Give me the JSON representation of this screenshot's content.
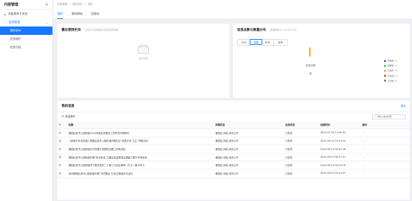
{
  "sidebar": {
    "title": "内容管理",
    "groups": [
      {
        "label": "内容发布工作台",
        "open": false
      },
      {
        "label": "信息管理",
        "open": true
      }
    ],
    "items": [
      {
        "label": "我的发布",
        "active": true
      },
      {
        "label": "信息维护",
        "active": false
      },
      {
        "label": "信息归档",
        "active": false
      }
    ]
  },
  "header": {
    "breadcrumb": [
      "信息管理",
      "/",
      "我的发布",
      "/",
      "我的"
    ],
    "tabs": [
      "我的",
      "我的审核",
      "回收站"
    ]
  },
  "recent": {
    "title": "最近使用栏目",
    "hint": "点击可以快速定位到对应的频道",
    "empty_text": "暂无数据"
  },
  "stats": {
    "title": "信息总数与数量分布",
    "hint": "数据更新于 2024-09-30",
    "filters": [
      "今日",
      "本周",
      "本月",
      "全年"
    ],
    "active_filter": "本周",
    "total_label": "信息总数",
    "total_value": "0",
    "accent_color": "#e3b400"
  },
  "chart_data": {
    "type": "bar",
    "categories": [
      "草稿箱",
      "待审核",
      "已发布",
      "已驳回",
      "已归档"
    ],
    "values": [
      0,
      0,
      0,
      0,
      0
    ],
    "colors": [
      "#1677ff",
      "#2fc25b",
      "#f5a623",
      "#e8453c",
      "#9b59b6"
    ],
    "ylim": [
      0,
      0
    ]
  },
  "mine": {
    "title": "我的信息",
    "more": "更多",
    "batch_label": "批量操作",
    "search_placeholder": "请输入信息标题",
    "columns": [
      "标题",
      "所属栏目",
      "信息状态",
      "创建时间",
      "操作"
    ],
    "rows": [
      {
        "title": "雅园区各市公园街道2024年度志愿服务工作情况开展情况",
        "column": "雅园区 网站-政务公开",
        "status": "已发布",
        "time": "2024-07-18 11:06:51",
        "op": "..."
      },
      {
        "title": "【我是平安志愿者】雅园区各市公园街道开展社区“我是平安·卫生”专题活动",
        "column": "雅园区 网站-政务公开",
        "status": "已发布",
        "time": "2024-09-14 10:19:44",
        "op": "..."
      },
      {
        "title": "雅园区各市公园街道召开党建引领基层治理工作推进会",
        "column": "雅园区 网站-政务公开",
        "status": "已发布",
        "time": "2024-09-29 05:40:36",
        "op": "..."
      },
      {
        "title": "雅园区各市公园街道开展“岗位练兵”主题活动暨基层治理能力提升专项培训",
        "column": "雅园区 网站-政务公开",
        "status": "已发布",
        "time": "2024-09-29 06:37:07",
        "op": "..."
      },
      {
        "title": "雅园区各市公园街道学习贯彻党的二十届三中全会精神（扩大）集中学习",
        "column": "雅园区 网站-政务公开",
        "status": "已发布",
        "time": "2024-09-29 05:24:18",
        "op": "..."
      },
      {
        "title": "深化雅园区各市公园街道开展“专项整治”行动主题宣传月活动",
        "column": "雅园区 网站-政务公开",
        "status": "已发布",
        "time": "2024-09-29 05:19:37",
        "op": "..."
      }
    ]
  }
}
